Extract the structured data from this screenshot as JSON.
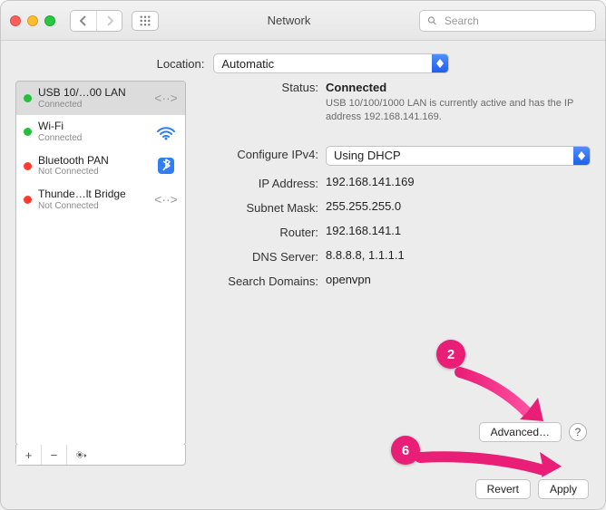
{
  "window": {
    "title": "Network"
  },
  "search": {
    "placeholder": "Search"
  },
  "location": {
    "label": "Location:",
    "value": "Automatic"
  },
  "sidebar": {
    "items": [
      {
        "name": "USB 10/…00 LAN",
        "sub": "Connected",
        "status": "green",
        "icon": "lan"
      },
      {
        "name": "Wi-Fi",
        "sub": "Connected",
        "status": "green",
        "icon": "wifi"
      },
      {
        "name": "Bluetooth PAN",
        "sub": "Not Connected",
        "status": "red",
        "icon": "bt"
      },
      {
        "name": "Thunde…lt Bridge",
        "sub": "Not Connected",
        "status": "red",
        "icon": "lan"
      }
    ]
  },
  "details": {
    "status_label": "Status:",
    "status_value": "Connected",
    "status_desc": "USB 10/100/1000 LAN is currently active and has the IP address 192.168.141.169.",
    "configure_label": "Configure IPv4:",
    "configure_value": "Using DHCP",
    "ip_label": "IP Address:",
    "ip_value": "192.168.141.169",
    "subnet_label": "Subnet Mask:",
    "subnet_value": "255.255.255.0",
    "router_label": "Router:",
    "router_value": "192.168.141.1",
    "dns_label": "DNS Server:",
    "dns_value": "8.8.8.8, 1.1.1.1",
    "search_label": "Search Domains:",
    "search_value": "openvpn"
  },
  "buttons": {
    "advanced": "Advanced…",
    "revert": "Revert",
    "apply": "Apply",
    "help": "?"
  },
  "annotations": {
    "b1": "2",
    "b2": "6"
  }
}
